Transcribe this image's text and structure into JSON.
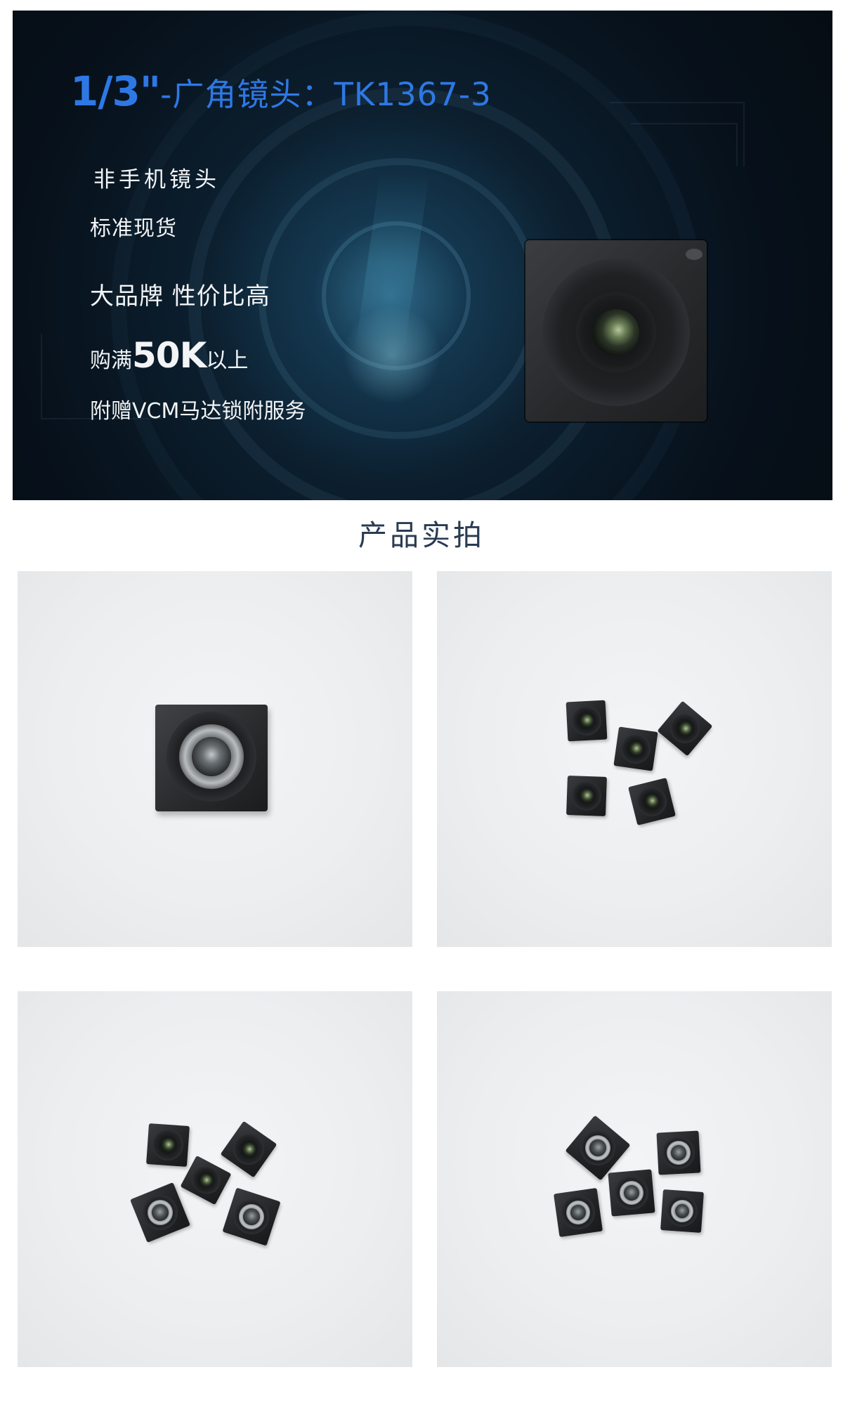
{
  "banner": {
    "title_main": "1/3\"",
    "title_rest": "-广角镜头：TK1367-3",
    "features": {
      "f1": "非手机镜头",
      "f2": "标准现货",
      "f3": "大品牌 性价比高",
      "f4_prefix": "购满",
      "f4_big": "50K",
      "f4_suffix": "以上",
      "f5": "附赠VCM马达锁附服务"
    },
    "colors": {
      "title": "#2e78e6",
      "feature_text": "#f2f4f6",
      "background": "#07111b"
    }
  },
  "section": {
    "title": "产品实拍",
    "color": "#2a3b52"
  },
  "photos": [
    {
      "name": "product-photo-single-module",
      "module_count": 1
    },
    {
      "name": "product-photo-five-modules-a",
      "module_count": 5
    },
    {
      "name": "product-photo-five-modules-b",
      "module_count": 5
    },
    {
      "name": "product-photo-five-modules-silver",
      "module_count": 5
    }
  ]
}
